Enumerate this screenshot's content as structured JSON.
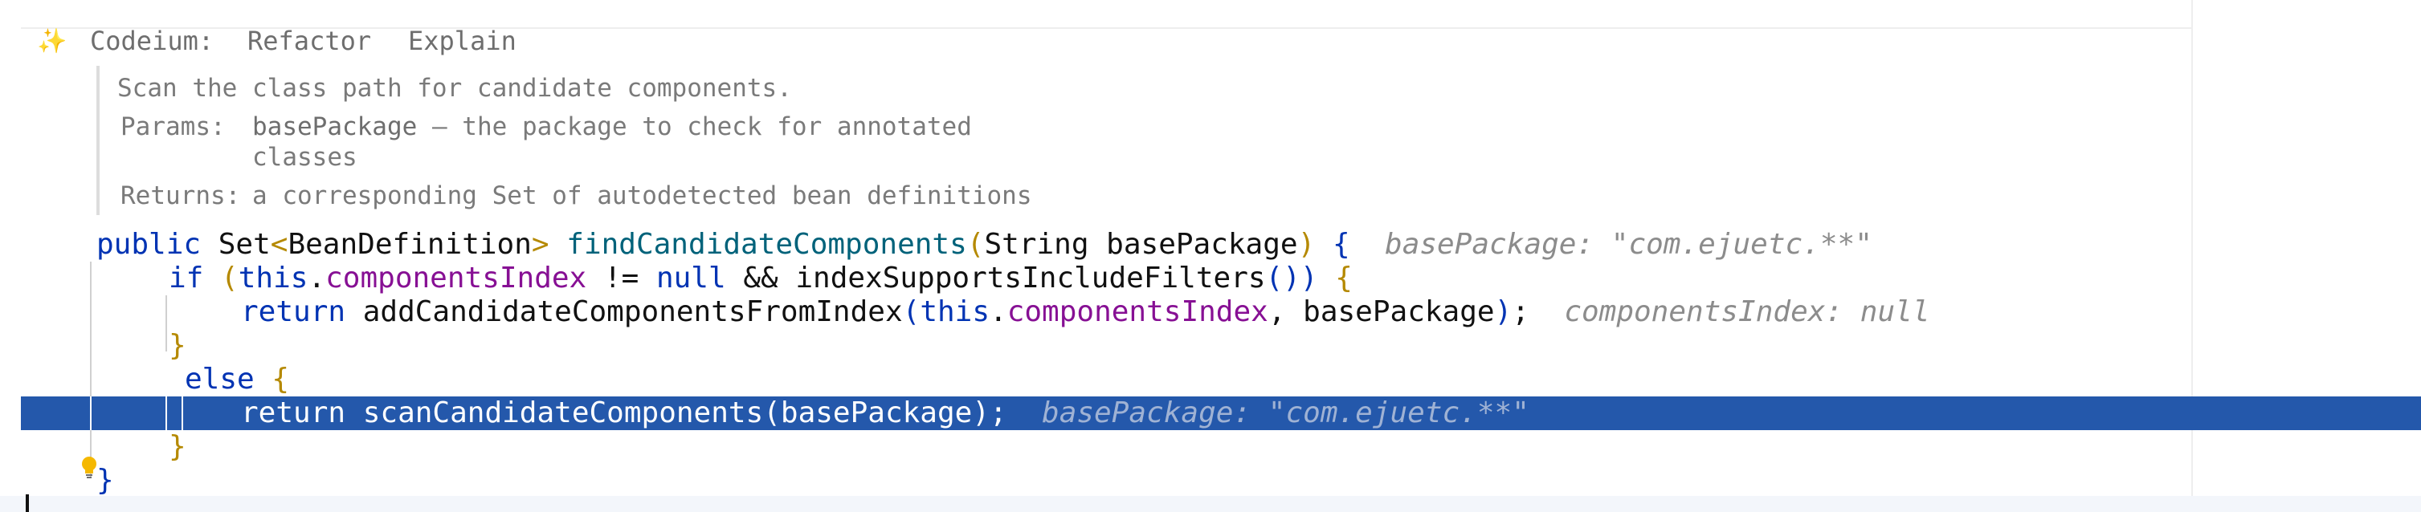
{
  "codeium": {
    "icon": "sparkle-icon",
    "label": "Codeium:",
    "actions": [
      "Refactor",
      "Explain"
    ]
  },
  "javadoc": {
    "summary": "Scan the class path for candidate components.",
    "params_label": "Params:",
    "param_name": "basePackage",
    "param_desc_1": "– the package to check for annotated",
    "param_desc_2": "classes",
    "returns_label": "Returns:",
    "returns_desc": "a corresponding Set of autodetected bean definitions"
  },
  "code": {
    "l1_public": "public",
    "l1_type": "Set",
    "l1_lt": "<",
    "l1_generic": "BeanDefinition",
    "l1_gt": ">",
    "l1_method": "findCandidateComponents",
    "l1_lp": "(",
    "l1_param": "String basePackage",
    "l1_rp": ")",
    "l1_brace": "{",
    "l1_hint": "basePackage: \"com.ejuetc.**\"",
    "l2_if": "if",
    "l2_lp": "(",
    "l2_this": "this",
    "l2_dot": ".",
    "l2_field": "componentsIndex",
    "l2_ne": " != ",
    "l2_null": "null",
    "l2_and": " && ",
    "l2_call": "indexSupportsIncludeFilters",
    "l2_parens": "()",
    "l2_rp": ")",
    "l2_brace": "{",
    "l3_return": "return",
    "l3_call": "addCandidateComponentsFromIndex",
    "l3_lp": "(",
    "l3_this": "this",
    "l3_dot": ".",
    "l3_field": "componentsIndex",
    "l3_rest": ", basePackage",
    "l3_rp": ")",
    "l3_semi": ";",
    "l3_hint": "componentsIndex: null",
    "l4_brace": "}",
    "l5_else": "else",
    "l5_brace": "{",
    "l6_return": "return",
    "l6_call": "scanCandidateComponents(basePackage);",
    "l6_hint": "basePackage: \"com.ejuetc.**\"",
    "l7_brace": "}",
    "l8_brace": "}"
  },
  "colors": {
    "keyword": "#0033b3",
    "method": "#00627a",
    "field": "#871094",
    "brace": "#b58900",
    "selection": "#2458ab"
  }
}
